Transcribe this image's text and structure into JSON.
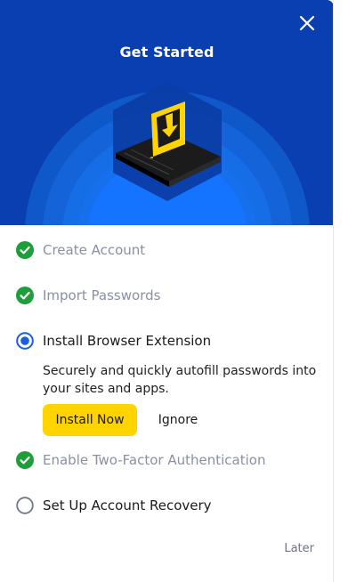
{
  "header": {
    "title": "Get Started",
    "close_icon": "close-icon"
  },
  "steps": [
    {
      "label": "Create Account",
      "status": "done",
      "icon": "check-circle-icon"
    },
    {
      "label": "Import Passwords",
      "status": "done",
      "icon": "check-circle-icon"
    },
    {
      "label": "Install Browser Extension",
      "status": "active",
      "icon": "radio-selected-icon"
    },
    {
      "label": "Enable Two-Factor Authentication",
      "status": "done",
      "icon": "check-circle-icon"
    },
    {
      "label": "Set Up Account Recovery",
      "status": "todo",
      "icon": "radio-empty-icon"
    }
  ],
  "active_step": {
    "description": "Securely and quickly autofill passwords into your sites and apps.",
    "install_label": "Install Now",
    "ignore_label": "Ignore"
  },
  "footer": {
    "later_label": "Later"
  },
  "colors": {
    "hero_bg": "#0a3fb2",
    "accent_yellow": "#ffd400",
    "check_green": "#1f9d3a",
    "radio_blue": "#1a5fe0",
    "done_text": "#8a8fa3"
  }
}
